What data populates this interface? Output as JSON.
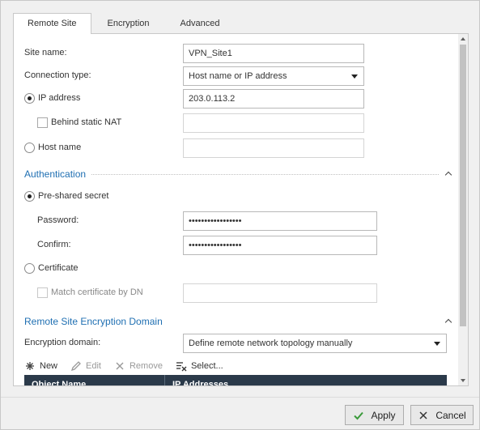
{
  "tabs": [
    {
      "label": "Remote Site",
      "active": true
    },
    {
      "label": "Encryption",
      "active": false
    },
    {
      "label": "Advanced",
      "active": false
    }
  ],
  "remote_site": {
    "site_name_label": "Site name:",
    "site_name_value": "VPN_Site1",
    "connection_type_label": "Connection type:",
    "connection_type_value": "Host name or IP address",
    "ip_address_label": "IP address",
    "ip_address_selected": true,
    "ip_address_value": "203.0.113.2",
    "behind_nat_label": "Behind static NAT",
    "behind_nat_checked": false,
    "behind_nat_value": "",
    "host_name_label": "Host name",
    "host_name_selected": false,
    "host_name_value": ""
  },
  "authentication": {
    "section_title": "Authentication",
    "psk_label": "Pre-shared secret",
    "psk_selected": true,
    "password_label": "Password:",
    "password_value": "•••••••••••••••••",
    "confirm_label": "Confirm:",
    "confirm_value": "•••••••••••••••••",
    "certificate_label": "Certificate",
    "certificate_selected": false,
    "match_dn_label": "Match certificate by DN",
    "match_dn_checked": false,
    "match_dn_value": ""
  },
  "encryption_domain": {
    "section_title": "Remote Site Encryption Domain",
    "domain_label": "Encryption domain:",
    "domain_value": "Define remote network topology manually",
    "toolbar": {
      "new": "New",
      "edit": "Edit",
      "remove": "Remove",
      "select": "Select..."
    },
    "table_columns": [
      "Object Name",
      "IP Addresses"
    ]
  },
  "footer": {
    "apply_label": "Apply",
    "cancel_label": "Cancel"
  },
  "colors": {
    "section_title": "#1f6fb2",
    "table_header": "#2b3a4a",
    "apply_check": "#3a9a3a"
  },
  "icons": {
    "new": "sparkle-icon",
    "edit": "pencil-icon",
    "remove": "x-icon",
    "select": "select-list-icon",
    "apply": "checkmark-icon",
    "cancel": "x-icon"
  }
}
